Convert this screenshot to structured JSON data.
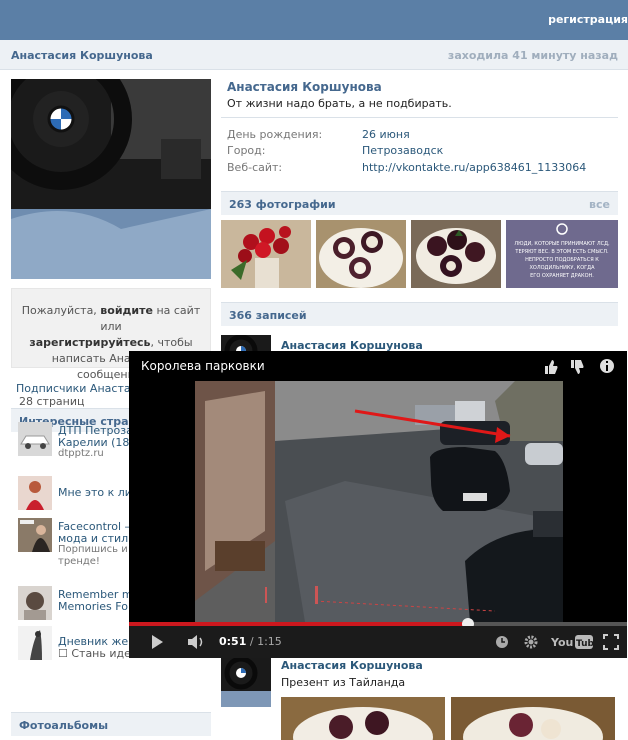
{
  "header": {
    "register": "регистрация"
  },
  "profile": {
    "name": "Анастасия Коршунова",
    "last_seen": "заходила 41 минуту назад",
    "status": "От жизни надо брать, а не подбирать.",
    "fields": [
      {
        "key": "День рождения:",
        "value": "26 июня"
      },
      {
        "key": "Город:",
        "value": "Петрозаводск"
      },
      {
        "key": "Веб-сайт:",
        "value": "http://vkontakte.ru/app638461_1133064"
      }
    ]
  },
  "login_box": {
    "p1": "Пожалуйста, ",
    "login": "войдите",
    "p2": " на сайт или",
    "register": "зарегистрируйтесь",
    "p3": ", чтобы",
    "p4": "написать Анастасии сообщение."
  },
  "followers_label": "Подписчики Анастаси",
  "interesting": {
    "title": "Интересные стран",
    "count": "28 страниц",
    "items": [
      {
        "line1": "ДТП Петрозав",
        "line2": "Карелии (18+",
        "line3": "dtpptz.ru"
      },
      {
        "line1": "Мне это к лиц",
        "line2": "",
        "line3": ""
      },
      {
        "line1": "Facecontrol —",
        "line2": "мода и стиль",
        "line3": "Порпишись и б",
        "line4": "тренде!"
      },
      {
        "line1": "Remember me",
        "line2": "Memories For Y",
        "line3": ""
      },
      {
        "line1": "Дневник женщин",
        "line2": "☐ Стань идеальной",
        "line3": ""
      }
    ]
  },
  "albums_title": "Фотоальбомы",
  "photos": {
    "title": "263 фотографии",
    "all": "все",
    "quote": "ЛЮДИ, КОТОРЫЕ ПРИНИМАЮТ ЛСД, ТЕРЯЮТ ВЕС. В ЭТОМ ЕСТЬ СМЫСЛ. НЕПРОСТО ПОДОБРАТЬСЯ К ХОЛОДИЛЬНИКУ, КОГДА ЕГО ОХРАНЯЕТ ДРАКОН."
  },
  "posts": {
    "title": "366 записей",
    "items": [
      {
        "author": "Анастасия Коршунова",
        "text": ""
      },
      {
        "author": "Анастасия Коршунова",
        "text": "Презент из Тайланда"
      }
    ]
  },
  "video": {
    "title": "Королева парковки",
    "current": "0:51",
    "duration": "/ 1:15",
    "progress": 0.68
  },
  "colors": {
    "topbar": "#5b7fa6",
    "link": "#2b587a",
    "accent_red": "#cc181e"
  }
}
